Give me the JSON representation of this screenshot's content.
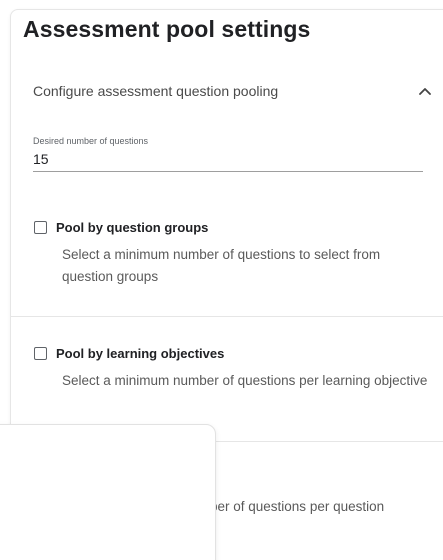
{
  "card": {
    "title": "Assessment pool settings"
  },
  "section": {
    "label": "Configure assessment question pooling",
    "chevron_icon": "chevron-up-icon"
  },
  "questions_field": {
    "label": "Desired number of questions",
    "value": "15"
  },
  "options": [
    {
      "title": "Pool by question groups",
      "description": "Select a minimum number of questions to select from question groups",
      "checked": false
    },
    {
      "title": "Pool by learning objectives",
      "description": "Select a minimum number of questions per learning objective",
      "checked": false
    }
  ],
  "partial_option": {
    "visible_description": "ber of questions per question"
  }
}
